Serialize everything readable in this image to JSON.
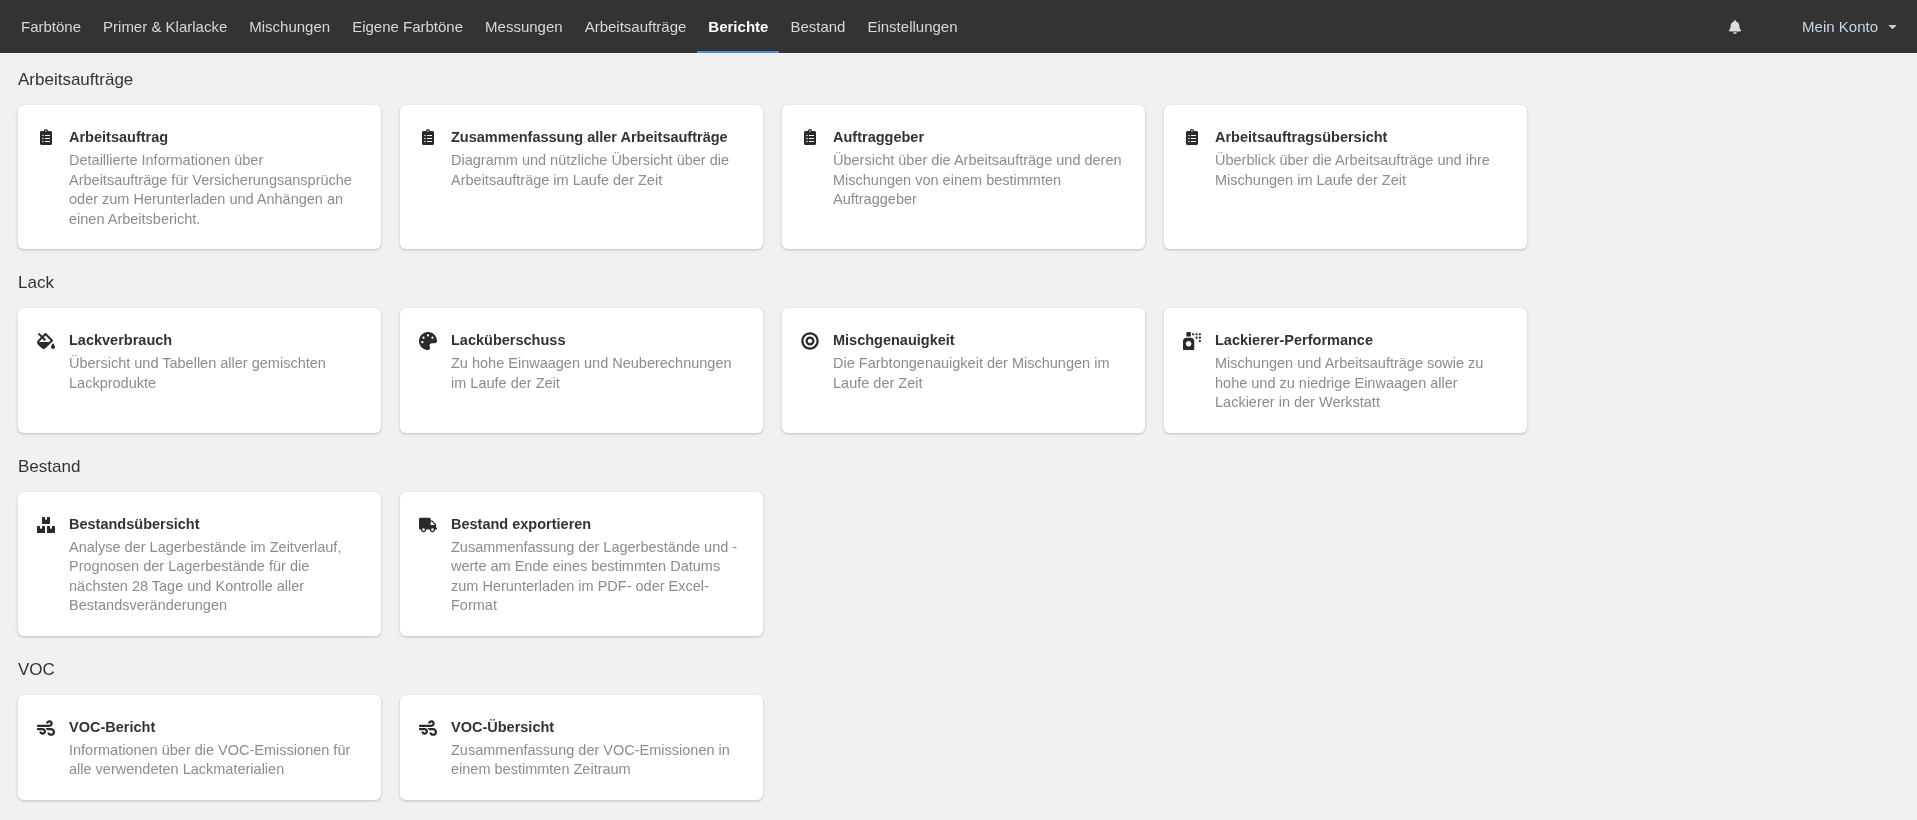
{
  "nav": {
    "tabs": [
      {
        "label": "Farbtöne",
        "selected": false
      },
      {
        "label": "Primer & Klarlacke",
        "selected": false
      },
      {
        "label": "Mischungen",
        "selected": false
      },
      {
        "label": "Eigene Farbtöne",
        "selected": false
      },
      {
        "label": "Messungen",
        "selected": false
      },
      {
        "label": "Arbeitsaufträge",
        "selected": false
      },
      {
        "label": "Berichte",
        "selected": true
      },
      {
        "label": "Bestand",
        "selected": false
      },
      {
        "label": "Einstellungen",
        "selected": false
      }
    ],
    "account": "Mein Konto"
  },
  "sections": [
    {
      "title": "Arbeitsaufträge",
      "cards": [
        {
          "title": "Arbeitsauftrag",
          "description": "Detaillierte Informationen über Arbeitsaufträge für Versicherungsansprüche oder zum Herunterladen und Anhängen an einen Arbeitsbericht."
        },
        {
          "title": "Zusammenfassung aller Arbeitsaufträge",
          "description": "Diagramm und nützliche Übersicht über die Arbeitsaufträge im Laufe der Zeit"
        },
        {
          "title": "Auftraggeber",
          "description": "Übersicht über die Arbeitsaufträge und deren Mischungen von einem bestimmten Auftraggeber"
        },
        {
          "title": "Arbeitsauftragsübersicht",
          "description": "Überblick über die Arbeitsaufträge und ihre Mischungen im Laufe der Zeit"
        }
      ]
    },
    {
      "title": "Lack",
      "cards": [
        {
          "title": "Lackverbrauch",
          "description": "Übersicht und Tabellen aller gemischten Lackprodukte"
        },
        {
          "title": "Lacküberschuss",
          "description": "Zu hohe Einwaagen und Neuberechnungen im Laufe der Zeit"
        },
        {
          "title": "Mischgenauigkeit",
          "description": "Die Farbtongenauigkeit der Mischungen im Laufe der Zeit"
        },
        {
          "title": "Lackierer-Performance",
          "description": "Mischungen und Arbeitsaufträge sowie zu hohe und zu niedrige Einwaagen aller Lackierer in der Werkstatt"
        }
      ]
    },
    {
      "title": "Bestand",
      "cards": [
        {
          "title": "Bestandsübersicht",
          "description": "Analyse der Lagerbestände im Zeitverlauf, Prognosen der Lagerbestände für die nächsten 28 Tage und Kontrolle aller Bestandsveränderungen"
        },
        {
          "title": "Bestand exportieren",
          "description": "Zusammenfassung der Lagerbestände und -werte am Ende eines bestimmten Datums zum Herunterladen im PDF- oder Excel-Format"
        }
      ]
    },
    {
      "title": "VOC",
      "cards": [
        {
          "title": "VOC-Bericht",
          "description": "Informationen über die VOC-Emissionen für alle verwendeten Lackmaterialien"
        },
        {
          "title": "VOC-Übersicht",
          "description": "Zusammenfassung der VOC-Emissionen in einem bestimmten Zeitraum"
        }
      ]
    }
  ]
}
